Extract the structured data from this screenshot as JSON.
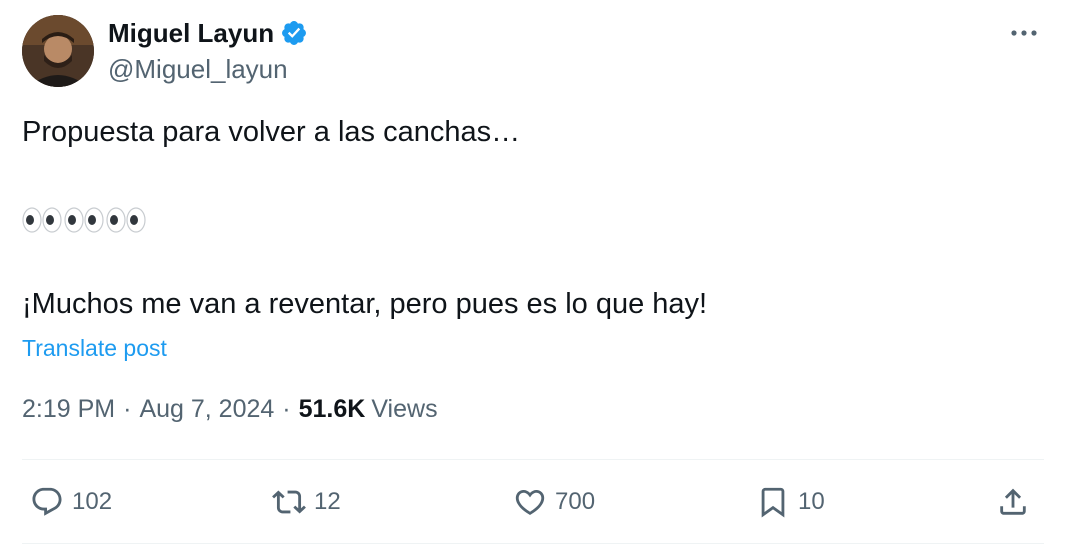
{
  "author": {
    "display_name": "Miguel Layun",
    "handle": "@Miguel_layun",
    "verified": true
  },
  "post": {
    "line1": "Propuesta para volver a las canchas…",
    "emoji": [
      "eyes",
      "eyes",
      "eyes"
    ],
    "line3": "¡Muchos me van a reventar, pero pues es lo que hay!",
    "translate_label": "Translate post"
  },
  "meta": {
    "time": "2:19 PM",
    "separator": "·",
    "date": "Aug 7, 2024",
    "views_count": "51.6K",
    "views_label": "Views"
  },
  "actions": {
    "replies": "102",
    "reposts": "12",
    "likes": "700",
    "bookmarks": "10"
  },
  "icons": {
    "verified": "verified-badge-icon",
    "more": "more-horizontal-icon",
    "reply": "reply-icon",
    "repost": "repost-icon",
    "like": "heart-icon",
    "bookmark": "bookmark-icon",
    "share": "share-icon"
  },
  "colors": {
    "text": "#0f1419",
    "secondary": "#536471",
    "link": "#1d9bf0",
    "verified": "#1d9bf0",
    "divider": "#eff3f4"
  }
}
